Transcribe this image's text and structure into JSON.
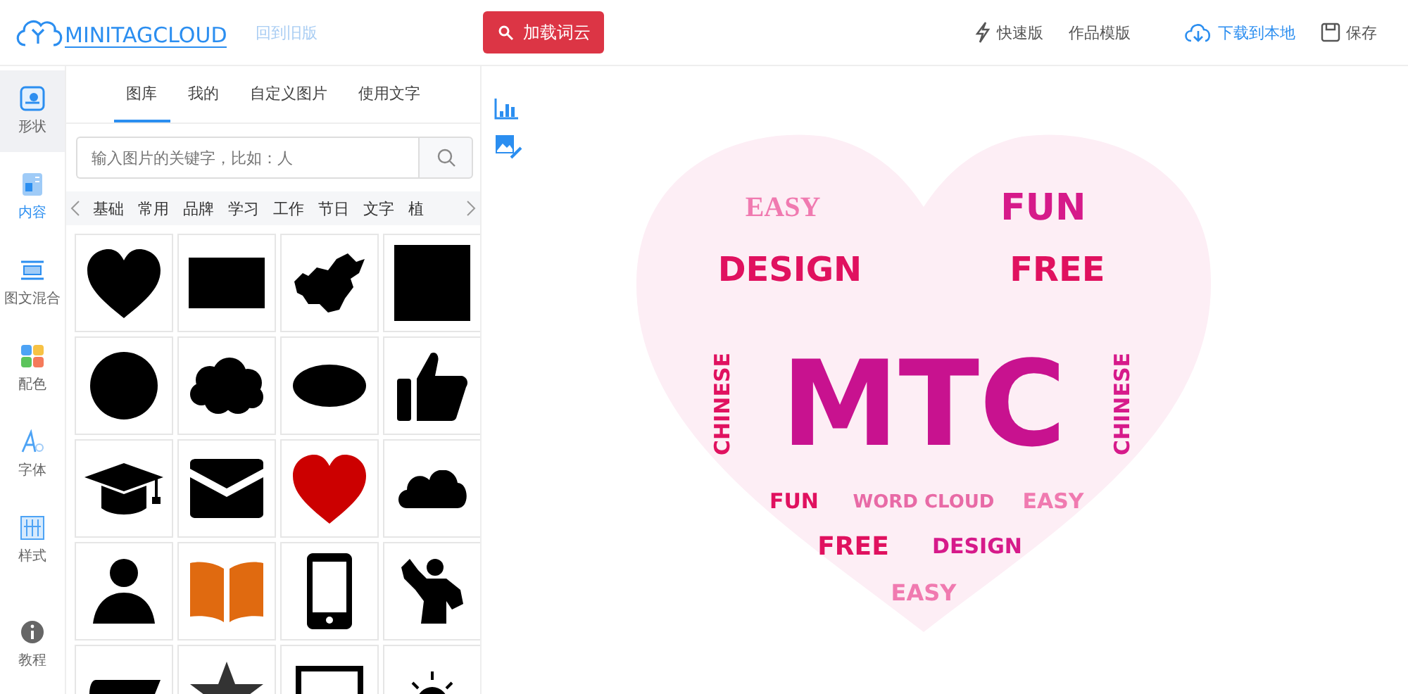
{
  "header": {
    "logo": "MINITAGCLOUD",
    "old_version_link": "回到旧版",
    "load_button": "加载词云",
    "actions": [
      {
        "kind": "bolt",
        "label": "快速版",
        "highlighted": false
      },
      {
        "kind": "plain",
        "label": "作品模版",
        "highlighted": false
      },
      {
        "kind": "download",
        "label": "下载到本地",
        "highlighted": true
      },
      {
        "kind": "save",
        "label": "保存",
        "highlighted": false
      }
    ]
  },
  "sidebar": {
    "items": [
      {
        "kind": "shape",
        "label": "形状",
        "selected": true
      },
      {
        "kind": "content",
        "label": "内容",
        "selected": false
      },
      {
        "kind": "mixed",
        "label": "图文混合",
        "selected": false
      },
      {
        "kind": "palette",
        "label": "配色",
        "selected": false
      },
      {
        "kind": "font",
        "label": "字体",
        "selected": false
      },
      {
        "kind": "style",
        "label": "样式",
        "selected": false
      },
      {
        "kind": "info",
        "label": "教程",
        "selected": false
      }
    ]
  },
  "panel": {
    "tabs": [
      {
        "label": "图库",
        "selected": true
      },
      {
        "label": "我的",
        "selected": false
      },
      {
        "label": "自定义图片",
        "selected": false
      },
      {
        "label": "使用文字",
        "selected": false
      }
    ],
    "search": {
      "placeholder": "输入图片的关键字，比如：人"
    },
    "categories": [
      "基础",
      "常用",
      "品牌",
      "学习",
      "工作",
      "节日",
      "文字",
      "植"
    ],
    "shapes": [
      {
        "kind": "heart",
        "color": "#000000"
      },
      {
        "kind": "rectangle",
        "color": "#000000"
      },
      {
        "kind": "map",
        "color": "#000000"
      },
      {
        "kind": "square",
        "color": "#000000"
      },
      {
        "kind": "circle",
        "color": "#000000"
      },
      {
        "kind": "bumpy-cloud",
        "color": "#000000"
      },
      {
        "kind": "ellipse",
        "color": "#000000"
      },
      {
        "kind": "thumbs-up",
        "color": "#000000"
      },
      {
        "kind": "graduation-cap",
        "color": "#000000"
      },
      {
        "kind": "envelope",
        "color": "#000000"
      },
      {
        "kind": "heart",
        "color": "#cc0000"
      },
      {
        "kind": "cloud",
        "color": "#000000"
      },
      {
        "kind": "person",
        "color": "#000000"
      },
      {
        "kind": "book",
        "color": "#e06a10"
      },
      {
        "kind": "phone",
        "color": "#000000"
      },
      {
        "kind": "bodybuilder",
        "color": "#000000"
      },
      {
        "kind": "tag",
        "color": "#000000"
      },
      {
        "kind": "star",
        "color": "#333333"
      },
      {
        "kind": "frame",
        "color": "#000000"
      },
      {
        "kind": "lightbulb",
        "color": "#000000"
      }
    ]
  },
  "word_cloud": {
    "words": [
      {
        "text": "EASY",
        "color": "#f07ab0"
      },
      {
        "text": "FUN",
        "color": "#d61a8a"
      },
      {
        "text": "DESIGN",
        "color": "#e0115f"
      },
      {
        "text": "FREE",
        "color": "#e0115f"
      },
      {
        "text": "CHINESE",
        "color": "#e0115f"
      },
      {
        "text": "MTC",
        "color": "#c8128f"
      },
      {
        "text": "CHINESE",
        "color": "#d61a8a"
      },
      {
        "text": "FUN",
        "color": "#e0115f"
      },
      {
        "text": "WORD CLOUD",
        "color": "#e86aa6"
      },
      {
        "text": "EASY",
        "color": "#f07ab0"
      },
      {
        "text": "FREE",
        "color": "#e0115f"
      },
      {
        "text": "DESIGN",
        "color": "#d61a8a"
      },
      {
        "text": "EASY",
        "color": "#f07ab0"
      }
    ]
  }
}
